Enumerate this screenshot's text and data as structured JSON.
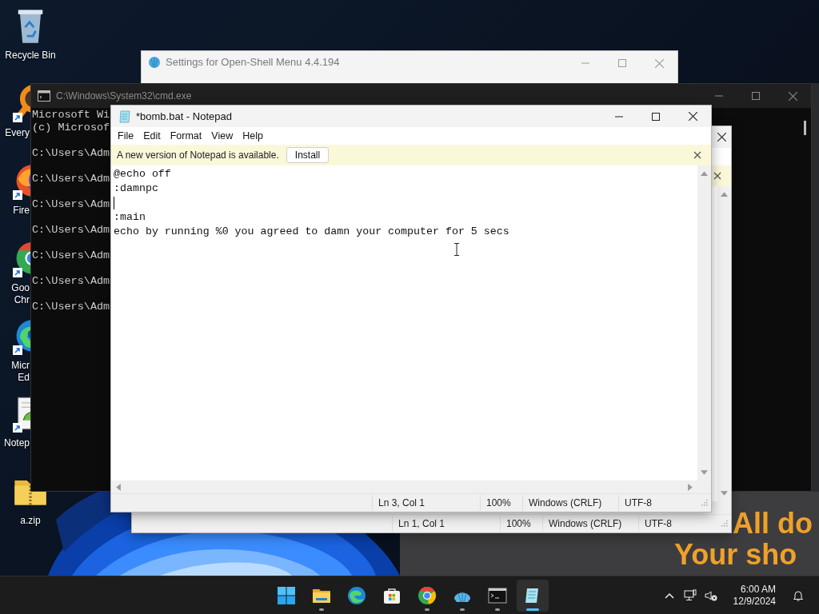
{
  "desktop": {
    "icons": [
      {
        "kind": "bin",
        "label": "Recycle Bin",
        "shortcut": false
      },
      {
        "kind": "magnifier",
        "label": "Every",
        "shortcut": true
      },
      {
        "kind": "fox",
        "label": "Fire",
        "shortcut": true
      },
      {
        "kind": "chrome",
        "label": "Goo\nChr",
        "shortcut": true
      },
      {
        "kind": "edge",
        "label": "Micr\nEd",
        "shortcut": true
      },
      {
        "kind": "notepad",
        "label": "Notep",
        "shortcut": true
      },
      {
        "kind": "zip",
        "label": "a.zip",
        "shortcut": false
      }
    ]
  },
  "settings_window": {
    "title": "Settings for Open-Shell Menu 4.4.194"
  },
  "console": {
    "title": "C:\\Windows\\System32\\cmd.exe",
    "header": [
      "Microsoft Wi",
      "(c) Microsof"
    ],
    "prompts": [
      "C:\\Users\\Adm",
      "C:\\Users\\Adm",
      "C:\\Users\\Adm",
      "C:\\Users\\Adm",
      "C:\\Users\\Adm",
      "C:\\Users\\Adm",
      "C:\\Users\\Adm"
    ]
  },
  "notepad_back": {
    "status": [
      "Ln 1, Col 1",
      "100%",
      "Windows (CRLF)",
      "UTF-8"
    ]
  },
  "notepad": {
    "title": "*bomb.bat - Notepad",
    "menu": [
      "File",
      "Edit",
      "Format",
      "View",
      "Help"
    ],
    "notice": {
      "text": "A new version of Notepad is available.",
      "button": "Install"
    },
    "lines": [
      {
        "text": "@echo off",
        "caret": false
      },
      {
        "text": ":damnpc",
        "caret": false
      },
      {
        "caret": true
      },
      {
        "text": ":main",
        "caret": false
      },
      {
        "text": "echo by running %0 you agreed to damn your computer for 5 secs",
        "caret": false
      }
    ],
    "status": [
      "Ln 3, Col 1",
      "100%",
      "Windows (CRLF)",
      "UTF-8"
    ]
  },
  "banner": {
    "lines": [
      "All do",
      "Your sho"
    ]
  },
  "taskbar": {
    "apps": [
      {
        "kind": "start",
        "running": false,
        "selected": false
      },
      {
        "kind": "explorer",
        "running": true,
        "selected": false
      },
      {
        "kind": "edge",
        "running": false,
        "selected": false
      },
      {
        "kind": "store",
        "running": false,
        "selected": false
      },
      {
        "kind": "chrome",
        "running": true,
        "selected": false
      },
      {
        "kind": "shell",
        "running": true,
        "selected": false
      },
      {
        "kind": "terminal",
        "running": true,
        "selected": false
      },
      {
        "kind": "notepad",
        "running": true,
        "selected": true
      }
    ],
    "clock": {
      "time": "6:00 AM",
      "date": "12/9/2024"
    }
  }
}
